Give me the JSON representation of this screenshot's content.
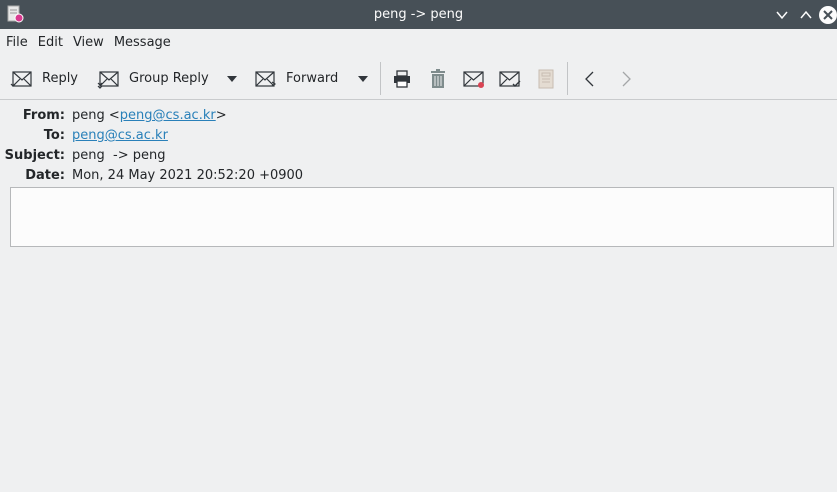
{
  "window": {
    "title": "peng -> peng"
  },
  "menu": {
    "items": [
      "File",
      "Edit",
      "View",
      "Message"
    ]
  },
  "toolbar": {
    "reply_label": "Reply",
    "group_reply_label": "Group Reply",
    "forward_label": "Forward"
  },
  "headers": {
    "from_label": "From:",
    "from_name": "peng <",
    "from_email": "peng@cs.ac.kr",
    "from_close": ">",
    "to_label": "To:",
    "to_email": "peng@cs.ac.kr",
    "subject_label": "Subject:",
    "subject": "peng  -> peng",
    "date_label": "Date:",
    "date": "Mon, 24 May 2021 20:52:20 +0900"
  },
  "colors": {
    "titlebar": "#475057",
    "background": "#eff0f1",
    "link": "#2980b9"
  }
}
